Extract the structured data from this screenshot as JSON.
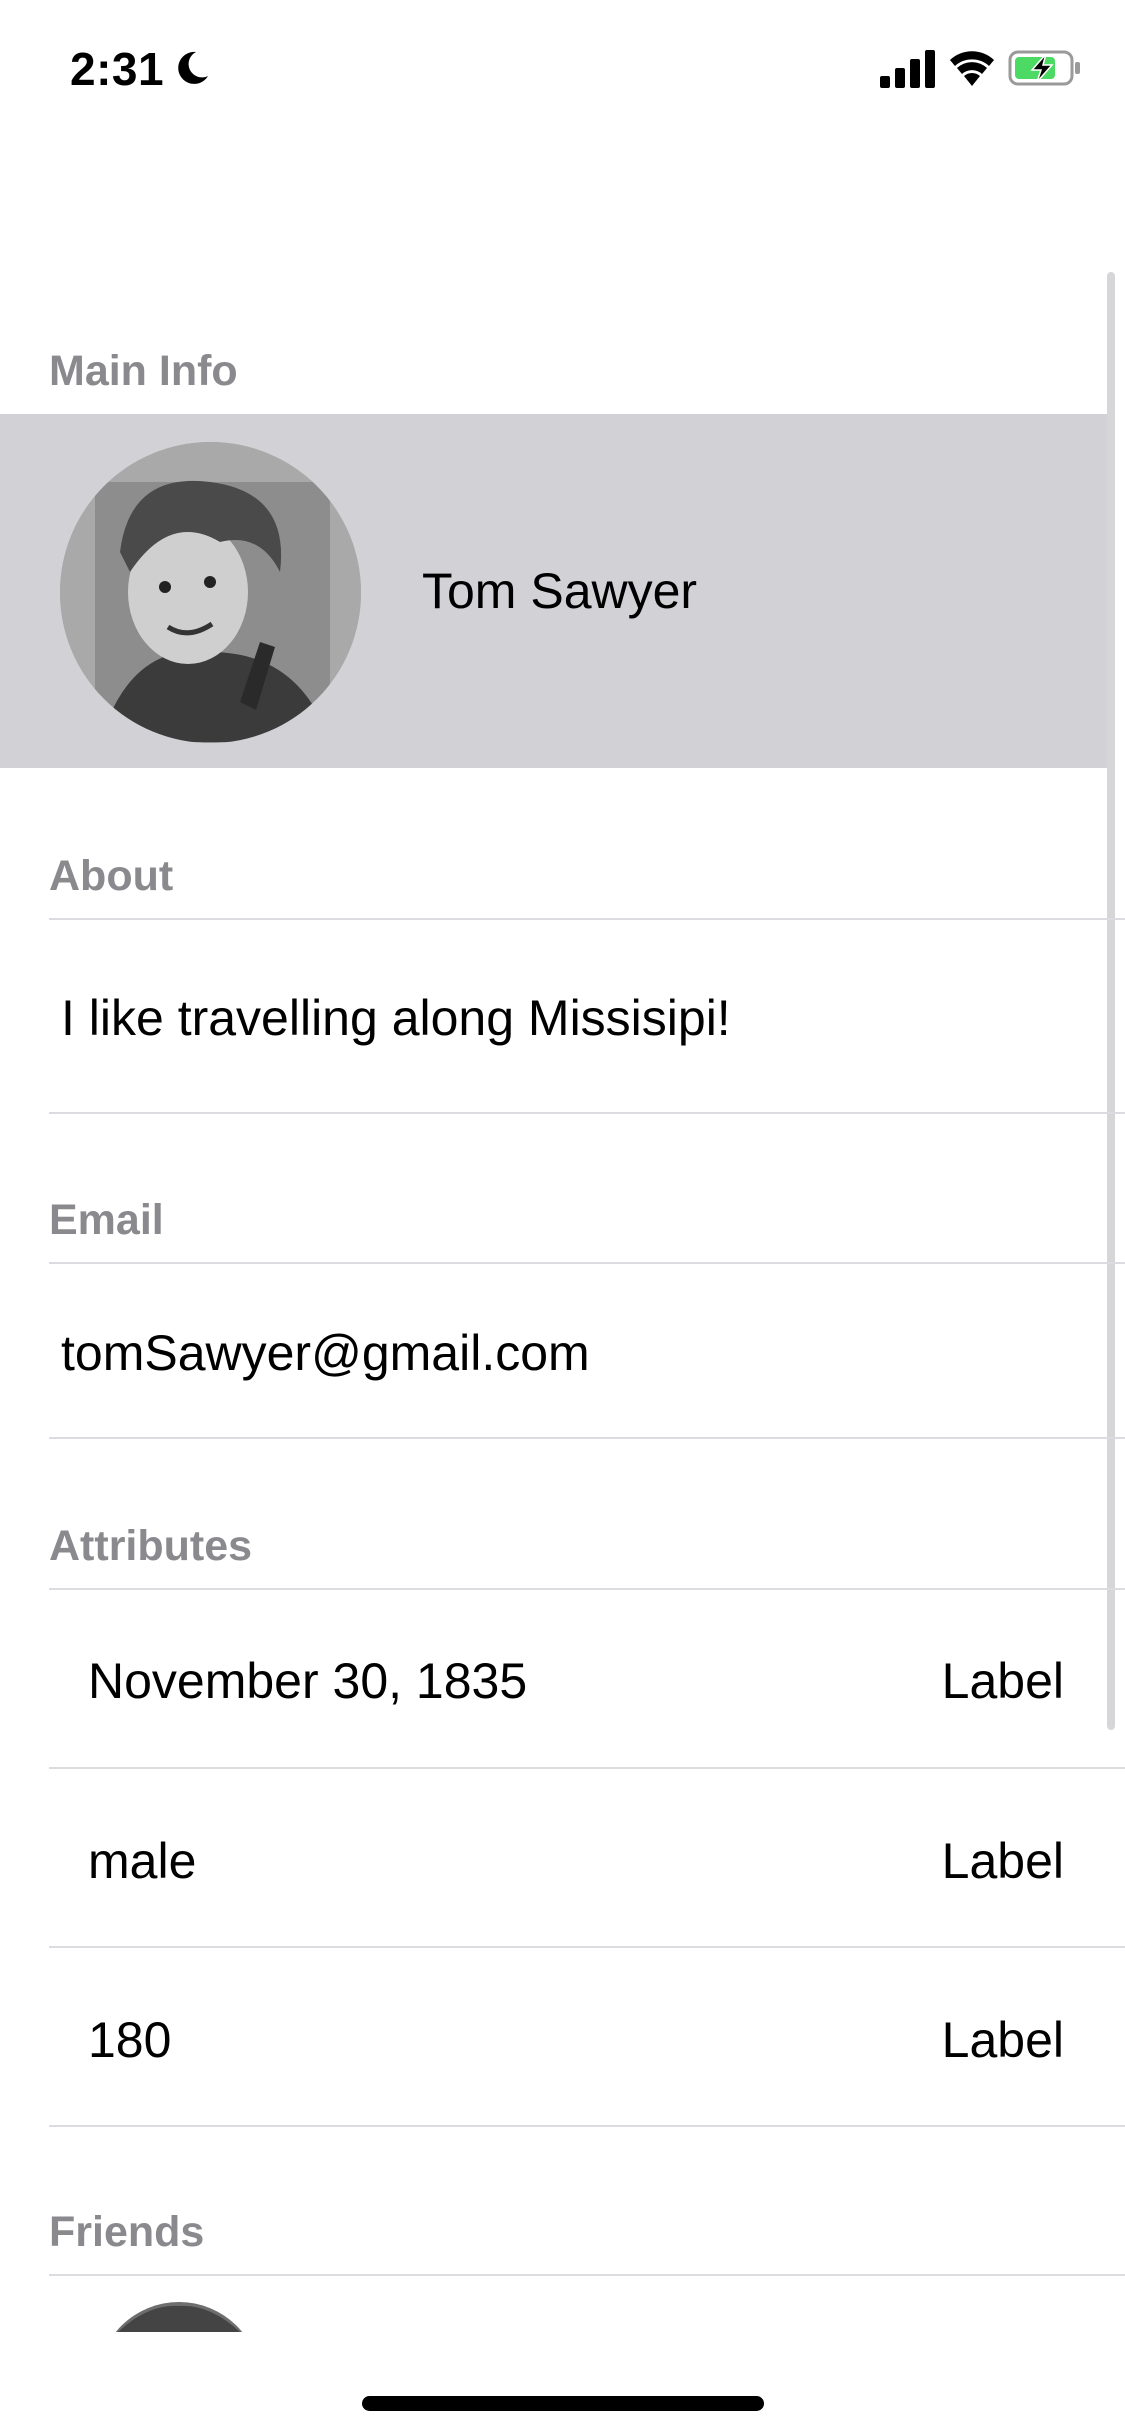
{
  "status_bar": {
    "time": "2:31",
    "icons": [
      "moon-icon",
      "signal-icon",
      "wifi-icon",
      "battery-charging-icon"
    ],
    "battery_color": "#4cd964"
  },
  "sections": {
    "main_info": {
      "header": "Main Info",
      "name": "Tom Sawyer"
    },
    "about": {
      "header": "About",
      "value": "I like travelling along Missisipi!"
    },
    "email": {
      "header": "Email",
      "value": "tomSawyer@gmail.com"
    },
    "attributes": {
      "header": "Attributes",
      "rows": [
        {
          "value": "November 30, 1835",
          "label": "Label"
        },
        {
          "value": "male",
          "label": "Label"
        },
        {
          "value": "180",
          "label": "Label"
        }
      ]
    },
    "friends": {
      "header": "Friends"
    }
  },
  "colors": {
    "highlight_row": "#d1d1d6",
    "section_header": "#8a8a8e",
    "separator": "#dcdce0"
  }
}
